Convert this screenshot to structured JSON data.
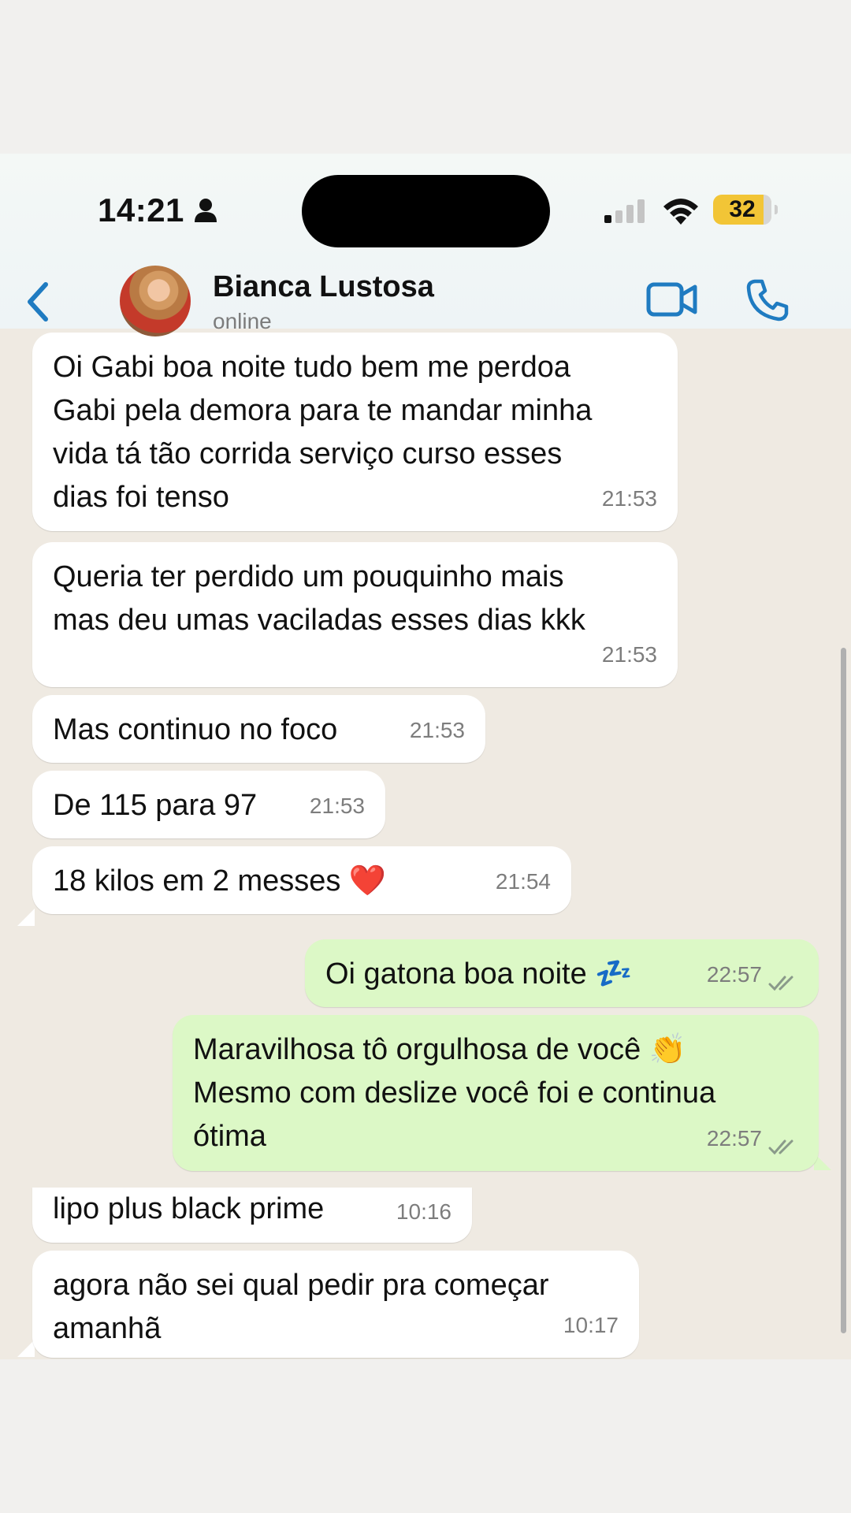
{
  "status_bar": {
    "time": "14:21",
    "battery": "32"
  },
  "header": {
    "name": "Bianca Lustosa",
    "status": "online"
  },
  "messages": [
    {
      "text": "Oi Gabi boa noite tudo bem me perdoa\nGabi pela demora para te mandar minha\nvida tá tão corrida serviço curso esses\ndias foi tenso",
      "time": "21:53"
    },
    {
      "text": "Queria ter perdido um pouquinho mais\nmas deu umas vaciladas esses dias kkk",
      "time": "21:53"
    },
    {
      "text": "Mas continuo no foco",
      "time": "21:53"
    },
    {
      "text": "De 115 para 97",
      "time": "21:53"
    },
    {
      "text": "18 kilos em 2 messes ❤️",
      "time": "21:54"
    },
    {
      "text": "Oi gatona boa noite 💤",
      "time": "22:57"
    },
    {
      "text": "Maravilhosa tô orgulhosa de você 👏\nMesmo com deslize você foi e continua\nótima",
      "time": "22:57"
    },
    {
      "text": "lipo plus black prime",
      "time": "10:16"
    },
    {
      "text": "agora não sei qual pedir pra começar\namanhã",
      "time": "10:17"
    }
  ],
  "colors": {
    "accent": "#1f7bc1",
    "incoming": "#ffffff",
    "outgoing": "#dcf8c6",
    "battery": "#f2c536"
  },
  "icons": [
    "person-icon",
    "signal-icon",
    "wifi-icon",
    "battery-icon",
    "back-chevron-icon",
    "video-call-icon",
    "phone-call-icon",
    "read-receipt-icon"
  ]
}
